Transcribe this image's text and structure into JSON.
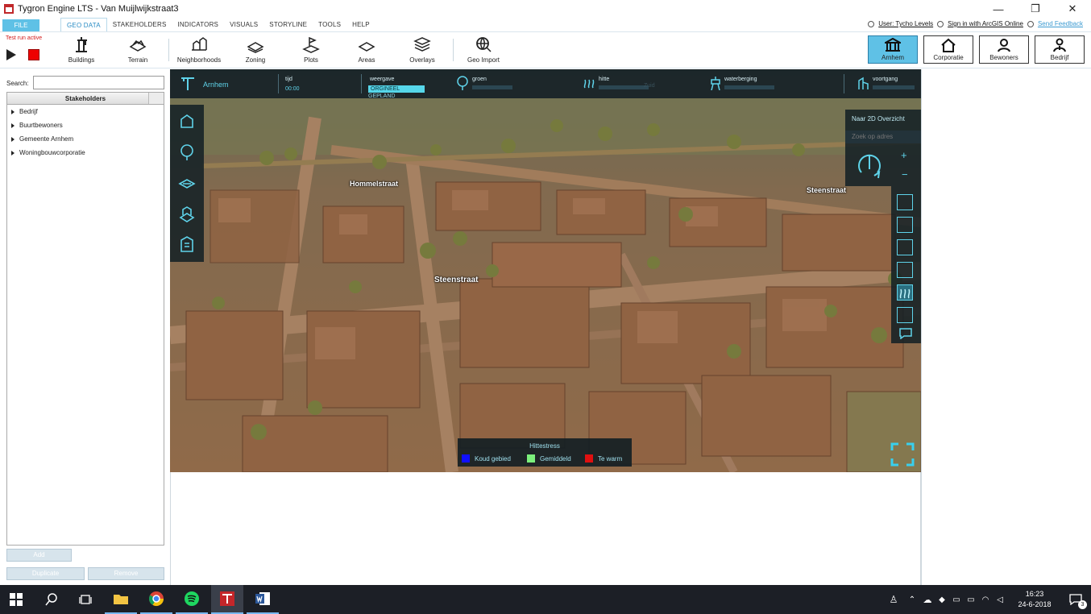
{
  "window": {
    "title": "Tygron Engine LTS - Van Muijlwijkstraat3",
    "minimize": "—",
    "maximize": "❐",
    "close": "✕"
  },
  "menu": {
    "file": "FILE",
    "tabs": [
      "GEO DATA",
      "STAKEHOLDERS",
      "INDICATORS",
      "VISUALS",
      "STORYLINE",
      "TOOLS",
      "HELP"
    ],
    "active_tab": "GEO DATA"
  },
  "user": {
    "user_label": "User: Tycho Levels",
    "arcgis": "Sign in with ArcGIS Online",
    "feedback": "Send Feedback"
  },
  "ribbon": {
    "test_run": "Test run active",
    "items": [
      "Buildings",
      "Terrain",
      "Neighborhoods",
      "Zoning",
      "Plots",
      "Areas",
      "Overlays",
      "Geo Import"
    ]
  },
  "stakeholder_buttons": [
    {
      "label": "Arnhem",
      "active": true
    },
    {
      "label": "Corporatie",
      "active": false
    },
    {
      "label": "Bewoners",
      "active": false
    },
    {
      "label": "Bedrijf",
      "active": false
    }
  ],
  "left_panel": {
    "search_label": "Search:",
    "search_value": "",
    "tree_header": "Stakeholders",
    "items": [
      "Bedrijf",
      "Buurtbewoners",
      "Gemeente Arnhem",
      "Woningbouwcorporatie"
    ],
    "add": "Add",
    "duplicate": "Duplicate",
    "remove": "Remove"
  },
  "hud": {
    "city": "Arnhem",
    "time_label": "tijd",
    "time_value": "00:00",
    "view_label": "weergave",
    "view_options": [
      "ORGINEEL",
      "GEPLAND"
    ],
    "indicators": [
      "groen",
      "hitte",
      "waterberging",
      "voortgang"
    ],
    "hint": "Zuid"
  },
  "navigation": {
    "overview_2d": "Naar 2D Overzicht",
    "address_search": "Zoek op adres",
    "zoom_in": "+",
    "zoom_out": "−"
  },
  "streets": [
    "Hommelstraat",
    "Steenstraat",
    "Steenstraat"
  ],
  "legend": {
    "title": "Hittestress",
    "items": [
      {
        "label": "Koud gebied",
        "color": "#1010ff"
      },
      {
        "label": "Gemiddeld",
        "color": "#7cf07c"
      },
      {
        "label": "Te warm",
        "color": "#e01010"
      }
    ]
  },
  "taskbar": {
    "time": "16:23",
    "date": "24-6-2018",
    "notifications": "3"
  }
}
